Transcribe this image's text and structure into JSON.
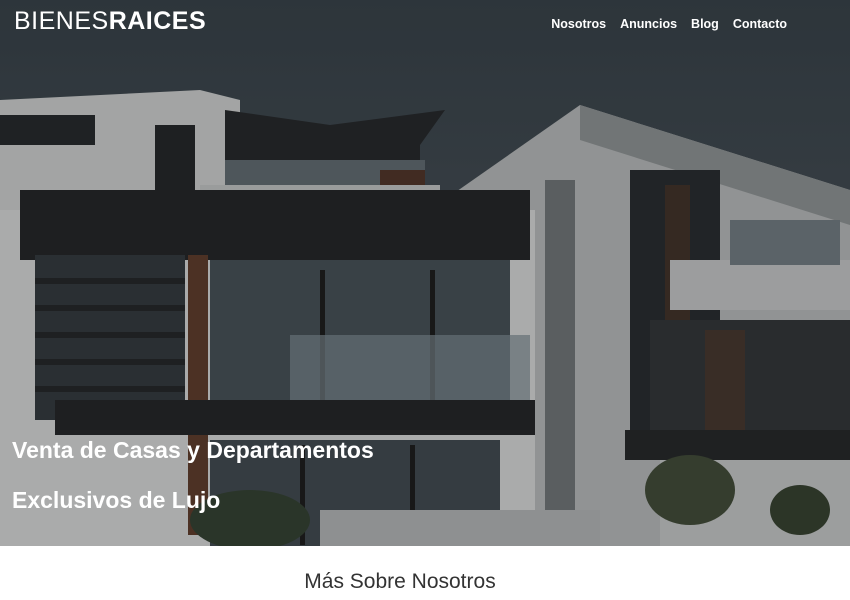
{
  "header": {
    "logo_light": "BIENES",
    "logo_bold": "RAICES",
    "nav": [
      "Nosotros",
      "Anuncios",
      "Blog",
      "Contacto"
    ]
  },
  "hero": {
    "title_line1": "Venta de Casas y Departamentos",
    "title_line2": "Exclusivos de Lujo"
  },
  "about": {
    "heading": "Más Sobre Nosotros"
  },
  "colors": {
    "text_light": "#ffffff",
    "text_dark": "#333333"
  }
}
